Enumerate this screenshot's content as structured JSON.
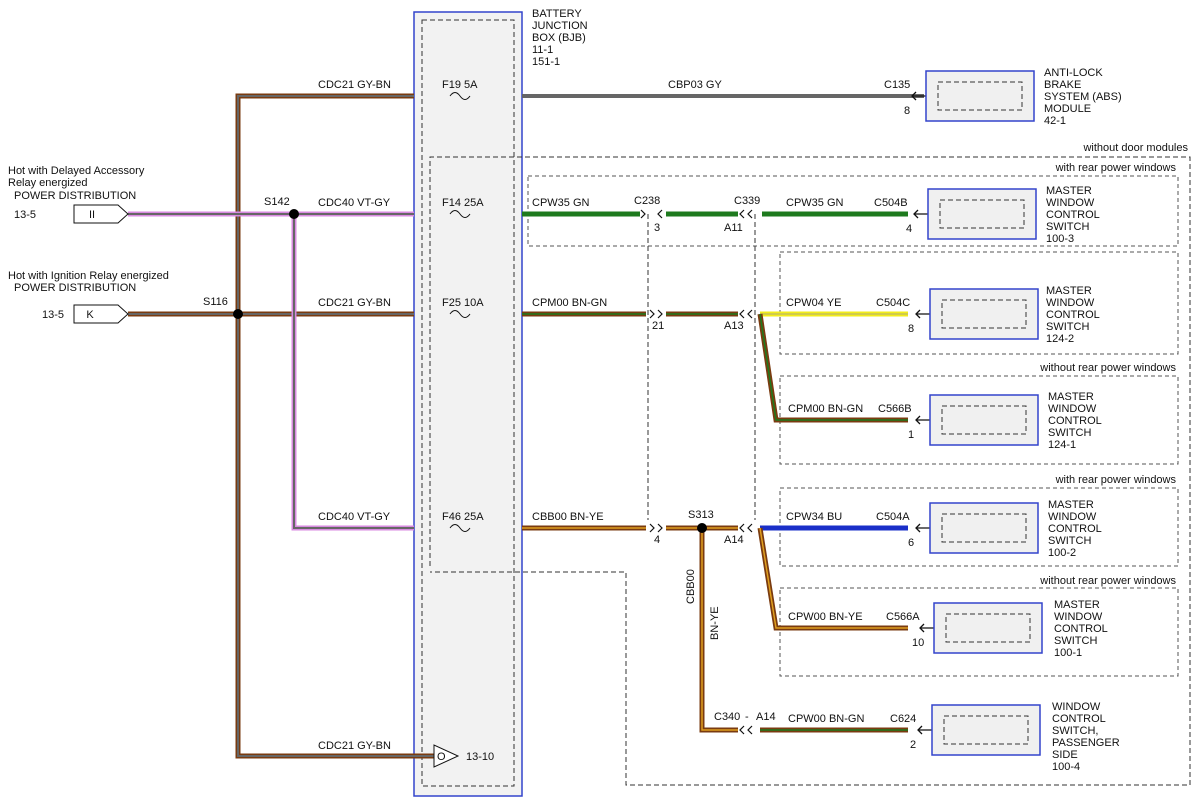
{
  "bjb": {
    "title": [
      "BATTERY",
      "JUNCTION",
      "BOX (BJB)"
    ],
    "refs": [
      "11-1",
      "151-1"
    ]
  },
  "sources": [
    {
      "desc": [
        "Hot with Delayed Accessory",
        "Relay energized"
      ],
      "label": "POWER DISTRIBUTION",
      "ref": "13-5",
      "pin": "II"
    },
    {
      "desc": [
        "Hot with Ignition Relay energized"
      ],
      "label": "POWER DISTRIBUTION",
      "ref": "13-5",
      "pin": "K"
    }
  ],
  "splices": [
    "S142",
    "S116",
    "S313"
  ],
  "input_circuits": [
    "CDC21  GY-BN",
    "CDC40  VT-GY",
    "CDC21  GY-BN",
    "CDC40  VT-GY",
    "CDC21  GY-BN"
  ],
  "fuses": [
    "F19  5A",
    "F14  25A",
    "F25  10A",
    "F46  25A"
  ],
  "ground": {
    "pin": "O",
    "ref": "13-10"
  },
  "circuits": [
    "CBP03  GY",
    "CPW35  GN",
    "CPW35  GN",
    "CPM00  BN-GN",
    "CPW04  YE",
    "CPM00  BN-GN",
    "CBB00  BN-YE",
    "CPW34  BU",
    "CPW00  BN-YE",
    "CPW00  BN-GN"
  ],
  "vertical_circuit": [
    "CBB00",
    "BN-YE"
  ],
  "connectors": [
    {
      "name": "C238",
      "pin": "3"
    },
    {
      "name": "C339",
      "pin": "A11"
    },
    {
      "pin": "21"
    },
    {
      "pin": "A13"
    },
    {
      "pin": "4"
    },
    {
      "pin": "A14"
    },
    {
      "name": "C340",
      "sep": "-",
      "pin": "A14"
    }
  ],
  "device_connectors": [
    {
      "name": "C135",
      "pin": "8"
    },
    {
      "name": "C504B",
      "pin": "4"
    },
    {
      "name": "C504C",
      "pin": "8"
    },
    {
      "name": "C566B",
      "pin": "1"
    },
    {
      "name": "C504A",
      "pin": "6"
    },
    {
      "name": "C566A",
      "pin": "10"
    },
    {
      "name": "C624",
      "pin": "2"
    }
  ],
  "devices": [
    {
      "lines": [
        "ANTI-LOCK",
        "BRAKE",
        "SYSTEM (ABS)",
        "MODULE"
      ],
      "ref": "42-1"
    },
    {
      "lines": [
        "MASTER",
        "WINDOW",
        "CONTROL",
        "SWITCH"
      ],
      "ref": "100-3"
    },
    {
      "lines": [
        "MASTER",
        "WINDOW",
        "CONTROL",
        "SWITCH"
      ],
      "ref": "124-2"
    },
    {
      "lines": [
        "MASTER",
        "WINDOW",
        "CONTROL",
        "SWITCH"
      ],
      "ref": "124-1"
    },
    {
      "lines": [
        "MASTER",
        "WINDOW",
        "CONTROL",
        "SWITCH"
      ],
      "ref": "100-2"
    },
    {
      "lines": [
        "MASTER",
        "WINDOW",
        "CONTROL",
        "SWITCH"
      ],
      "ref": "100-1"
    },
    {
      "lines": [
        "WINDOW",
        "CONTROL",
        "SWITCH,",
        "PASSENGER",
        "SIDE"
      ],
      "ref": "100-4"
    }
  ],
  "options": [
    "without door modules",
    "with rear power windows",
    "without rear power windows",
    "with rear power windows",
    "without rear power windows"
  ],
  "colors": {
    "GY": "#666666",
    "BN": "#7a3b10",
    "VT": "#d88ae0",
    "GN": "#1e7a1e",
    "YE": "#f2ec1a",
    "BU": "#1a2fc8",
    "BN-YE-stripe": "#e0a020",
    "box": "#3344cc"
  }
}
